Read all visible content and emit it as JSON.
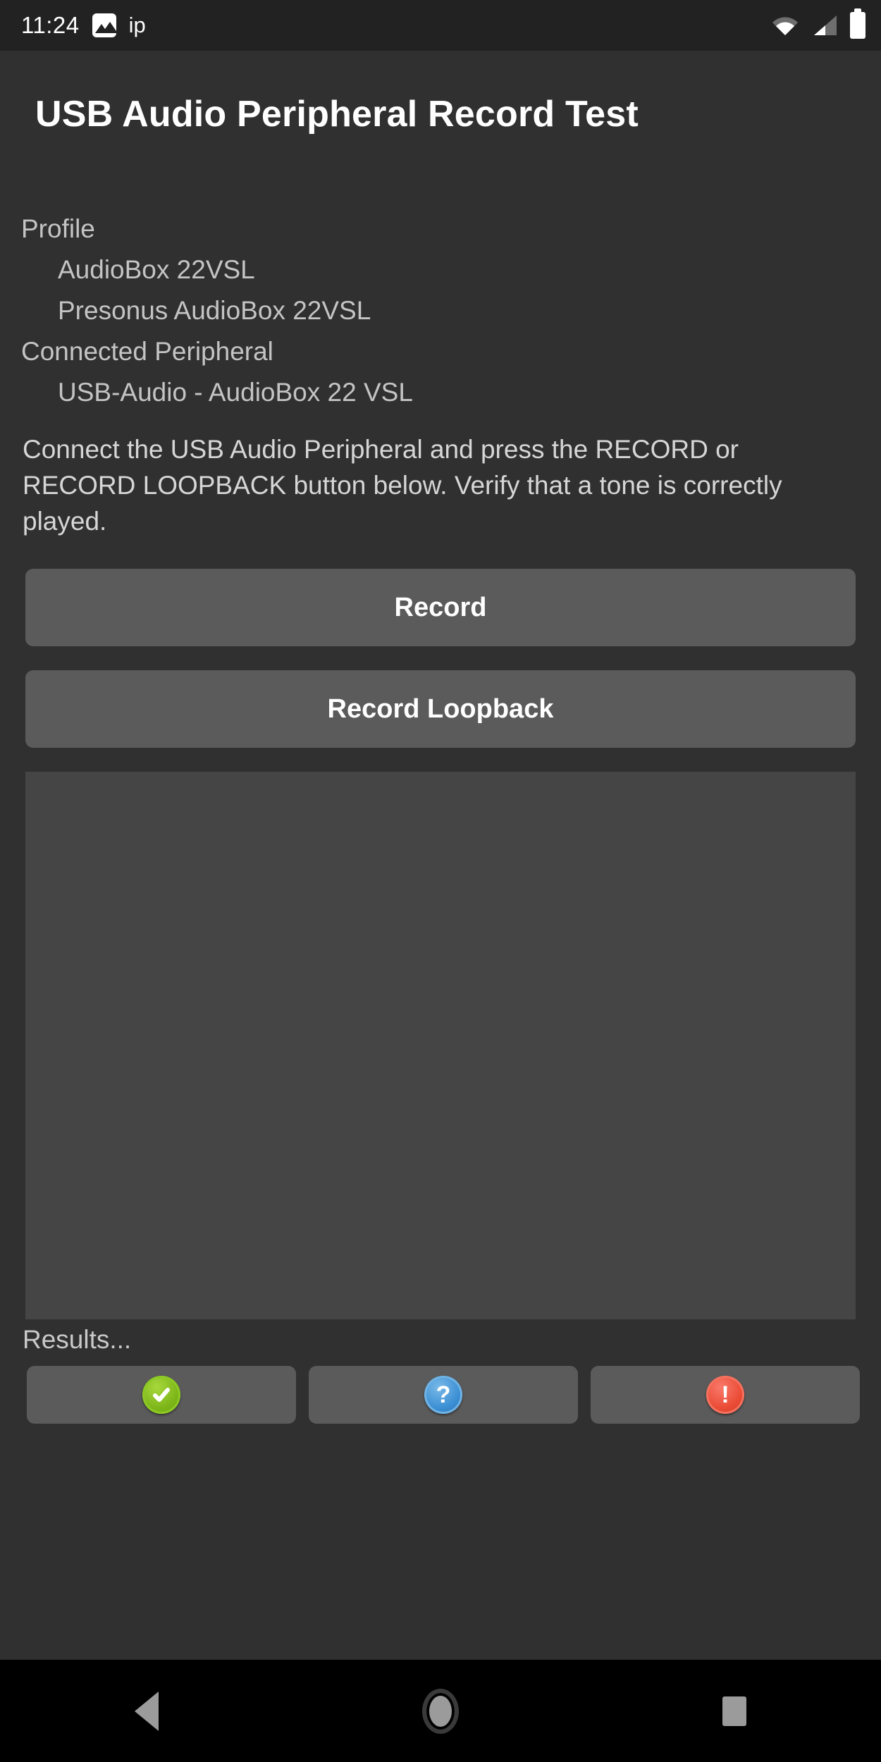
{
  "status_bar": {
    "time": "11:24",
    "image_icon": "image-icon",
    "notification_text": "ip",
    "wifi_icon": "wifi-icon",
    "signal_icon": "cell-signal-icon",
    "battery_icon": "battery-icon"
  },
  "app": {
    "title": "USB Audio Peripheral Record Test"
  },
  "info": {
    "profile_label": "Profile",
    "profile_name": "AudioBox 22VSL",
    "profile_vendor": "Presonus AudioBox 22VSL",
    "connected_label": "Connected Peripheral",
    "connected_device": "USB-Audio - AudioBox 22 VSL"
  },
  "instructions": "Connect the USB Audio Peripheral and press the RECORD or RECORD LOOPBACK button below. Verify that a tone is correctly played.",
  "buttons": {
    "record": "Record",
    "record_loopback": "Record Loopback"
  },
  "results": {
    "panel_text": "",
    "label": "Results...",
    "actions": [
      {
        "name": "pass",
        "glyph": "✔",
        "color": "#7cb518"
      },
      {
        "name": "info",
        "glyph": "?",
        "color": "#3b8fd4"
      },
      {
        "name": "fail",
        "glyph": "!",
        "color": "#ea4b35"
      }
    ]
  },
  "nav_bar": {
    "back": "back-icon",
    "home": "home-icon",
    "recents": "recents-icon"
  },
  "colors": {
    "background": "#303030",
    "status_bar": "#222222",
    "button": "#5b5b5b",
    "panel": "#454545",
    "nav_bar": "#000000"
  }
}
